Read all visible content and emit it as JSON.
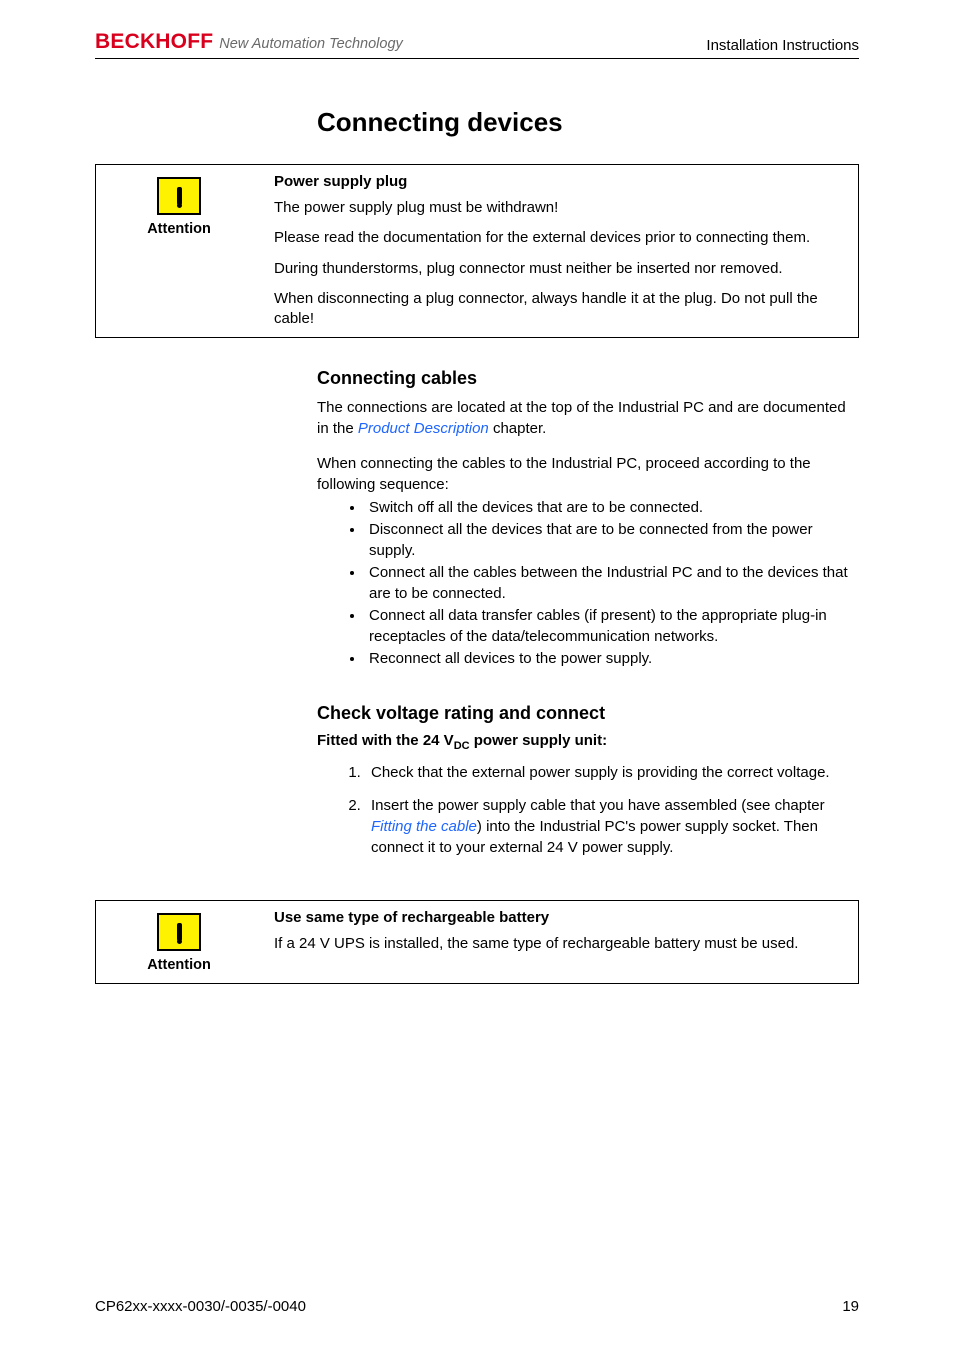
{
  "header": {
    "brand": "BECKHOFF",
    "tagline": "New Automation Technology",
    "right": "Installation Instructions"
  },
  "title": "Connecting devices",
  "box1": {
    "label": "Attention",
    "title": "Power supply plug",
    "p1": "The power supply plug must be withdrawn!",
    "p2": "Please read the documentation for the external devices prior to connecting them.",
    "p3": "During thunderstorms, plug connector must neither be inserted nor removed.",
    "p4": "When disconnecting a plug connector, always handle it at the plug. Do not pull the cable!"
  },
  "sect1": {
    "title": "Connecting cables",
    "intro_pre": "The connections are located at the top of the Industrial PC and are documented in the ",
    "intro_link": "Product Description",
    "intro_post": " chapter.",
    "lead": "When connecting the cables to the Industrial PC, proceed according to the following sequence:",
    "bullets": [
      "Switch off all the devices that are to be connected.",
      "Disconnect all the devices that are to be connected from the power supply.",
      "Connect all the cables between the Industrial PC and to the devices that are to be connected.",
      "Connect all data transfer cables (if present) to the appropriate plug-in receptacles of the data/telecommunication networks.",
      "Reconnect all devices to the power supply."
    ]
  },
  "sect2": {
    "title": "Check voltage rating and connect",
    "sub_pre": "Fitted with the 24 V",
    "sub_dc": "DC",
    "sub_post": " power supply unit:",
    "item1": "Check that the external power supply is providing the correct voltage.",
    "item2_pre": "Insert the power supply cable that you have assembled (see chapter ",
    "item2_link": "Fitting the cable",
    "item2_post": ") into the Industrial PC's power supply socket. Then connect it to your external 24 V power supply."
  },
  "box2": {
    "label": "Attention",
    "title": "Use same type of rechargeable battery",
    "p1": "If a 24 V UPS is installed, the same type of rechargeable battery must be used."
  },
  "footer": {
    "left": "CP62xx-xxxx-0030/-0035/-0040",
    "right": "19"
  }
}
